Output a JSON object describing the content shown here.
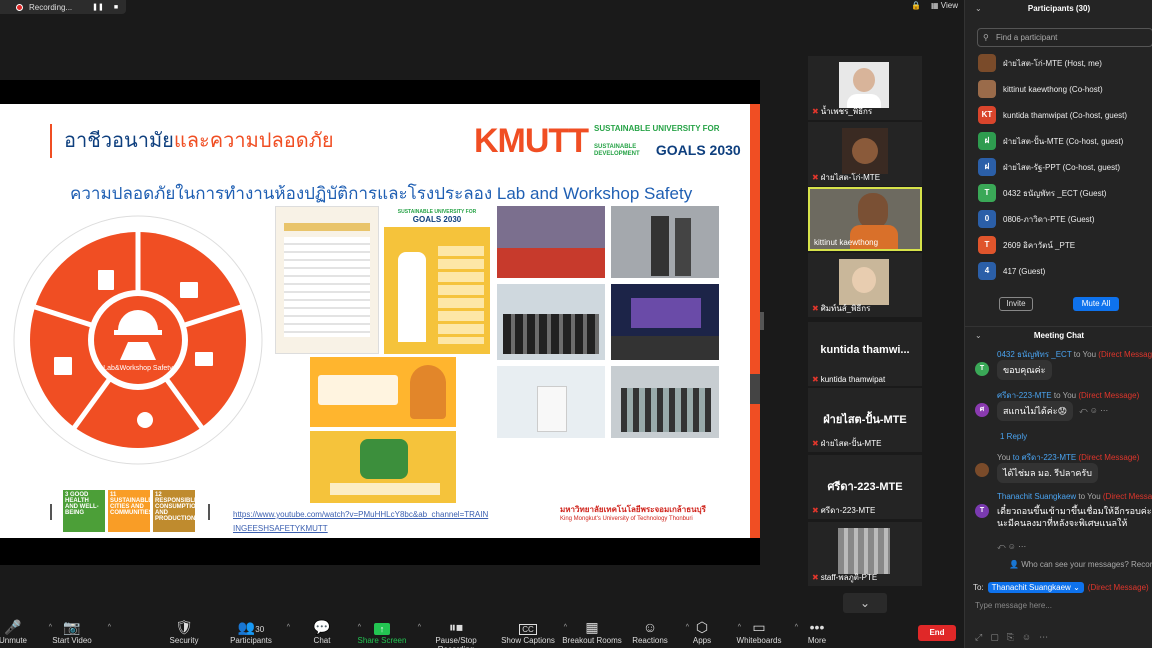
{
  "recording": {
    "label": "Recording..."
  },
  "top_right": {
    "view_label": "View"
  },
  "slide": {
    "title_part1": "อาชีวอนามัย",
    "title_part2": "และความปลอดภัย",
    "brand": "KMUTT",
    "sustainable": "SUSTAINABLE UNIVERSITY FOR",
    "goals_small": "SUSTAINABLE DEVELOPMENT",
    "goals": "GOALS 2030",
    "subtitle": "ความปลอดภัยในการทำงานห้องปฏิบัติการและโรงประลอง Lab and Workshop Safety",
    "ring_center": "Lab&Workshop Safety",
    "url_line1": "https://www.youtube.com/watch?v=PMuHHLcY8bc&ab_channel=TRAIN",
    "url_line2": "INGEESHSAFETYKMUTT",
    "uni_th": "มหาวิทยาลัยเทคโนโลยีพระจอมเกล้าธนบุรี",
    "uni_en": "King Mongkut's University of Technology Thonburi",
    "poster2_title": "SUSTAINABLE UNIVERSITY FOR",
    "poster2_goals": "GOALS 2030",
    "sdgs": [
      {
        "num": "3",
        "label": "GOOD HEALTH AND WELL-BEING",
        "color": "#4c9f38"
      },
      {
        "num": "11",
        "label": "SUSTAINABLE CITIES AND COMMUNITIES",
        "color": "#f99d26"
      },
      {
        "num": "12",
        "label": "RESPONSIBLE CONSUMPTION AND PRODUCTION",
        "color": "#bf8b2e"
      }
    ]
  },
  "gallery": [
    {
      "name": "น้ำเพชร_พิธีกร",
      "muted": true
    },
    {
      "name": "ฝ่ายไสต-โก่-MTE",
      "muted": true
    },
    {
      "name": "kittinut kaewthong",
      "muted": false,
      "active": true
    },
    {
      "name": "ศิมท์นส์_พิธีกร",
      "muted": true
    },
    {
      "name": "kuntida thamwipat",
      "big": "kuntida  thamwi...",
      "muted": true
    },
    {
      "name": "ฝ่ายไสต-ปั้น-MTE",
      "big": "ฝ่ายไสต-ปั้น-MTE",
      "muted": true
    },
    {
      "name": "ศรีดา-223-MTE",
      "big": "ศรีดา-223-MTE",
      "muted": true
    },
    {
      "name": "staff-พลภูติ-PTE",
      "muted": true
    }
  ],
  "toolbar": [
    {
      "label": "Unmute",
      "icon": "microphone-muted-icon",
      "glyph": "🎤"
    },
    {
      "label": "Start Video",
      "icon": "video-off-icon",
      "glyph": "📷"
    },
    {
      "label": "Security",
      "icon": "shield-icon",
      "glyph": "🛡"
    },
    {
      "label": "Participants",
      "icon": "participants-icon",
      "glyph": "👥",
      "count": "30"
    },
    {
      "label": "Chat",
      "icon": "chat-icon",
      "glyph": "💬"
    },
    {
      "label": "Share Screen",
      "icon": "share-screen-icon",
      "glyph": "↑"
    },
    {
      "label": "Pause/Stop Recording",
      "icon": "pause-stop-icon",
      "glyph": "⏸⏹"
    },
    {
      "label": "Show Captions",
      "icon": "captions-icon",
      "glyph": "CC"
    },
    {
      "label": "Breakout Rooms",
      "icon": "breakout-rooms-icon",
      "glyph": "▦"
    },
    {
      "label": "Reactions",
      "icon": "reactions-icon",
      "glyph": "☺"
    },
    {
      "label": "Apps",
      "icon": "apps-icon",
      "glyph": "⬡"
    },
    {
      "label": "Whiteboards",
      "icon": "whiteboard-icon",
      "glyph": "▭"
    },
    {
      "label": "More",
      "icon": "more-icon",
      "glyph": "•••"
    }
  ],
  "end_label": "End",
  "participants": {
    "title": "Participants (30)",
    "search_placeholder": "Find a participant",
    "list": [
      {
        "name": "ฝ่ายไสต-โก่-MTE (Host, me)",
        "initial": "",
        "color": "#7a4b2a"
      },
      {
        "name": "kittinut kaewthong (Co-host)",
        "initial": "",
        "color": "#9a6b4a"
      },
      {
        "name": "kuntida thamwipat (Co-host, guest)",
        "initial": "KT",
        "color": "#d9452c"
      },
      {
        "name": "ฝ่ายไสต-ปั้น-MTE (Co-host, guest)",
        "initial": "ฝ",
        "color": "#2e9c4f"
      },
      {
        "name": "ฝ่ายไสต-รัฐ-PPT (Co-host, guest)",
        "initial": "ฝ",
        "color": "#2b5fa8"
      },
      {
        "name": "0432 ธนัญพัทร _ECT (Guest)",
        "initial": "T",
        "color": "#3aa857"
      },
      {
        "name": "0806-ภาวิดา-PTE (Guest)",
        "initial": "0",
        "color": "#2b5fa8"
      },
      {
        "name": "2609 อิคาวัตน์ _PTE",
        "initial": "T",
        "color": "#e0552c"
      },
      {
        "name": "417 (Guest)",
        "initial": "4",
        "color": "#2b5fa8"
      }
    ],
    "invite_label": "Invite",
    "mute_all_label": "Mute All"
  },
  "chat": {
    "title": "Meeting Chat",
    "messages": [
      {
        "from": "0432 ธนัญพัทร _ECT",
        "to": "to You",
        "dm": "(Direct Message)",
        "text": "ขอบคุณค่ะ",
        "initial": "T",
        "color": "#3aa857"
      },
      {
        "from": "ศรีดา-223-MTE",
        "to": "to You",
        "dm": "(Direct Message)",
        "text": "สแกนไม่ได้ค่ะ😟",
        "initial": "ศ",
        "color": "#8a3ab0",
        "reply": "1 Reply"
      },
      {
        "from": "You",
        "to": "to ศรีดา-223-MTE",
        "dm": "(Direct Message)",
        "text": "ได้ไช่มล มอ. รีปลาครับ",
        "initial": "",
        "color": "#7a4b2a"
      },
      {
        "from": "Thanachit Suangkaew",
        "to": "to You",
        "dm": "(Direct Message)",
        "text": "เดี๋ยวถอนขึ้นเข้ามาขึ้นเชื่อมให้อีกรอบค่ะ",
        "text2": "นะมีคนลงมาที่หลังจะพิเศษแนลให้",
        "initial": "T",
        "color": "#7a3ab0"
      }
    ],
    "who_can_see": "Who can see your messages? Recording",
    "to_label": "To:",
    "to_recipient": "Thanachit Suangkaew",
    "to_dm": "(Direct Message)",
    "compose_placeholder": "Type message here..."
  }
}
